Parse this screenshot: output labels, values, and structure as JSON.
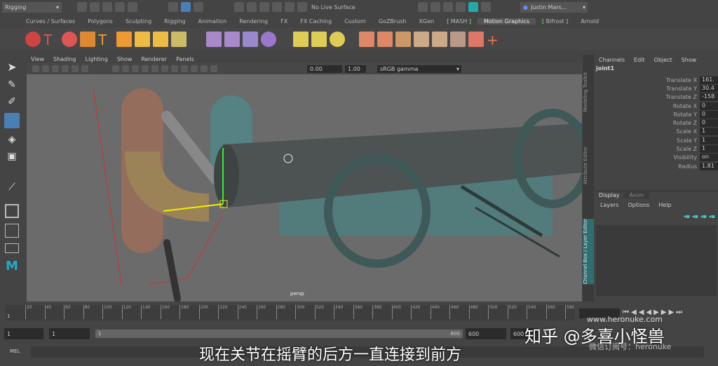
{
  "status_line": {
    "mode": "Rigging",
    "live_surface": "No Live Surface",
    "user": "Justin Mars..."
  },
  "shelf_tabs": [
    "Curves / Surfaces",
    "Polygons",
    "Sculpting",
    "Rigging",
    "Animation",
    "Rendering",
    "FX",
    "FX Caching",
    "Custom",
    "GoZBrush",
    "XGen",
    "MASH",
    "Motion Graphics",
    "Bifrost",
    "Arnold"
  ],
  "viewport": {
    "menu": [
      "View",
      "Shading",
      "Lighting",
      "Show",
      "Renderer",
      "Panels"
    ],
    "exposure": "0.00",
    "gamma": "1.00",
    "color_space": "sRGB gamma",
    "camera": "persp"
  },
  "side_tabs": [
    "Modeling Toolkit",
    "Attribute Editor",
    "Channel Box / Layer Editor"
  ],
  "channel_box": {
    "menu": [
      "Channels",
      "Edit",
      "Object",
      "Show"
    ],
    "object": "joint1",
    "channels": [
      {
        "label": "Translate X",
        "value": "161."
      },
      {
        "label": "Translate Y",
        "value": "30.4"
      },
      {
        "label": "Translate Z",
        "value": "-158"
      },
      {
        "label": "Rotate X",
        "value": "0"
      },
      {
        "label": "Rotate Y",
        "value": "0"
      },
      {
        "label": "Rotate Z",
        "value": "0"
      },
      {
        "label": "Scale X",
        "value": "1"
      },
      {
        "label": "Scale Y",
        "value": "1"
      },
      {
        "label": "Scale Z",
        "value": "1"
      },
      {
        "label": "Visibility",
        "value": "on"
      },
      {
        "label": "Radius",
        "value": "1.81"
      }
    ]
  },
  "layer_editor": {
    "tabs": [
      "Display",
      "Anim"
    ],
    "menu": [
      "Layers",
      "Options",
      "Help"
    ]
  },
  "timeline": {
    "ticks": [
      "20",
      "40",
      "60",
      "80",
      "100",
      "120",
      "140",
      "160",
      "180",
      "200",
      "220",
      "240",
      "260",
      "280",
      "300",
      "320",
      "340",
      "360",
      "380",
      "400",
      "420",
      "440",
      "460",
      "480",
      "500",
      "520",
      "540",
      "560",
      "580"
    ],
    "current_frame": "1"
  },
  "range": {
    "start": "1",
    "playback_start": "1",
    "slider_start": "1",
    "slider_end": "600",
    "playback_end": "600",
    "end": "600"
  },
  "command_line": {
    "label": "MEL"
  },
  "overlay": {
    "watermark_url": "www.heronuke.com",
    "zhihu": "知乎 @多喜小怪兽",
    "wechat": "微信订阅号：heronuke",
    "subtitle": "现在关节在摇臂的后方一直连接到前方"
  }
}
